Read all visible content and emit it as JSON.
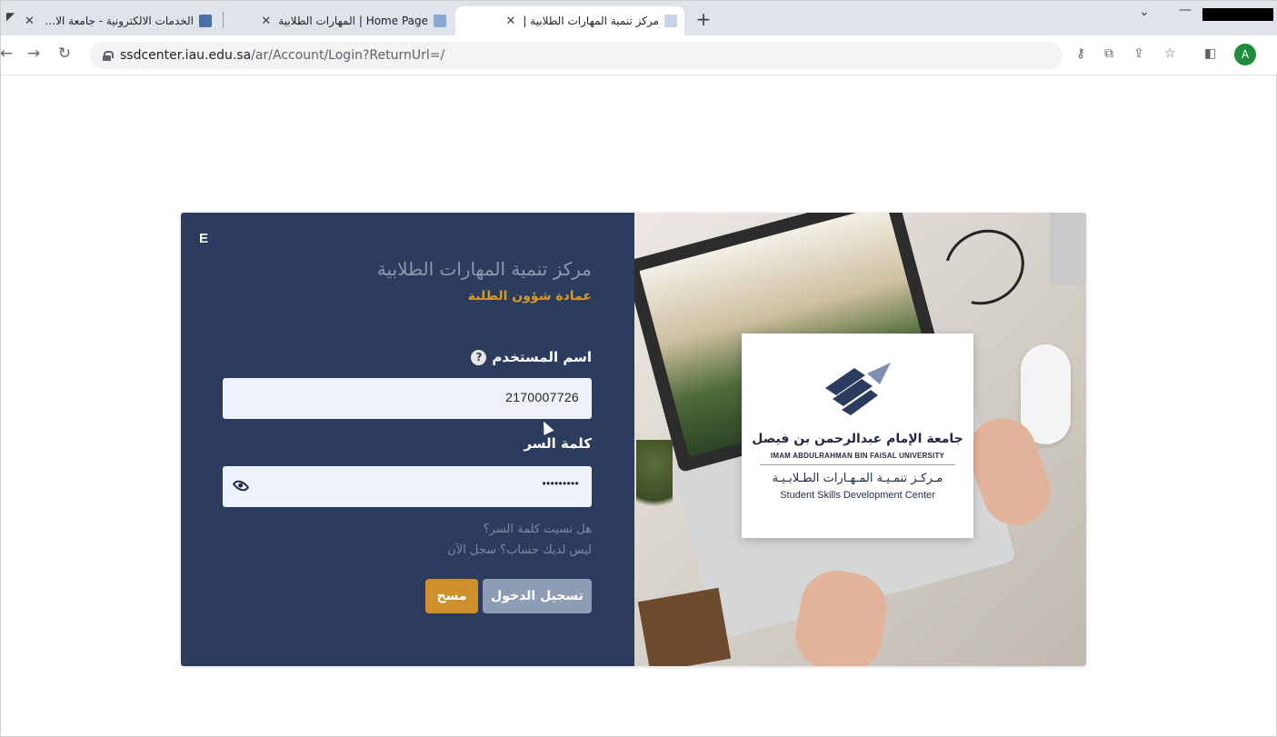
{
  "browser": {
    "tabs": [
      {
        "title": "الخدمات الالكترونية - جامعة الامام",
        "favicon_color": "#4a6fa5"
      },
      {
        "title": "Home Page | المهارات الطلابية",
        "favicon_color": "#8aa7d8"
      },
      {
        "title": "مركز تنمية المهارات الطلابية |",
        "favicon_color": "#c8d3e6"
      }
    ],
    "new_tab": "+",
    "url_host": "ssdcenter.iau.edu.sa",
    "url_path": "/ar/Account/Login?ReturnUrl=/",
    "profile_initial": "A"
  },
  "login": {
    "lang_switch": "E",
    "center_name": "مركز تنمية المهارات الطلابية",
    "deanship": "عمادة شؤون الطلبة",
    "username_label": "اسم المستخدم",
    "username_value": "2170007726",
    "password_label": "كلمة السر",
    "password_value": "•••••••••",
    "forgot_password": "هل نسيت كلمة السر؟",
    "register": "ليس لديك حساب؟ سجل الآن",
    "login_button": "تسجيل الدخول",
    "clear_button": "مسح"
  },
  "logo": {
    "university_ar": "جامعة الإمام عبدالرحمن بن فيصل",
    "university_en": "IMAM ABDULRAHMAN BIN FAISAL UNIVERSITY",
    "center_ar": "مـركـز تنمـيـة المـهـارات الطـلابـيـة",
    "center_en": "Student Skills Development Center"
  },
  "colors": {
    "panel_bg": "#2b3c5e",
    "accent_gold": "#d49a2a",
    "login_button": "#8e9cb6",
    "clear_button": "#cf8f2a"
  }
}
